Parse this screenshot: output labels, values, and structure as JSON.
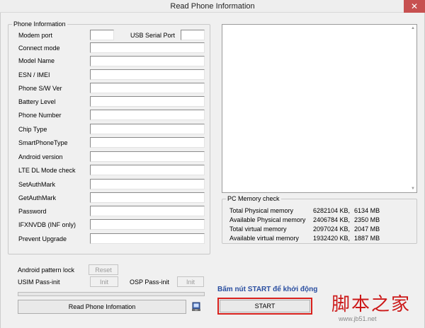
{
  "window": {
    "title": "Read Phone Information",
    "close_glyph": "✕"
  },
  "phone_info": {
    "group_label": "Phone Information",
    "modem_port_label": "Modem port",
    "usb_serial_port_label": "USB Serial Port",
    "fields": [
      "Connect mode",
      "Model Name",
      "ESN / IMEI",
      "Phone S/W Ver",
      "Battery Level",
      "Phone Number",
      "Chip Type",
      "SmartPhoneType",
      "Android version",
      "LTE DL Mode check",
      "SetAuthMark",
      "GetAuthMark",
      "Password",
      "IFXNVDB (INF only)",
      "Prevent Upgrade"
    ]
  },
  "actions": {
    "android_pattern_lock_label": "Android pattern lock",
    "reset_label": "Reset",
    "usim_pass_init_label": "USIM Pass-init",
    "osp_pass_init_label": "OSP Pass-init",
    "init_label": "Init",
    "read_phone_info_label": "Read Phone Infomation",
    "phone_icon": "phone-icon"
  },
  "pc_memory": {
    "group_label": "PC Memory check",
    "rows": [
      {
        "label": "Total Physical memory",
        "kb": "6282104 KB,",
        "mb": "6134 MB"
      },
      {
        "label": "Available Physical memory",
        "kb": "2406784 KB,",
        "mb": "2350 MB"
      },
      {
        "label": "Total virtual memory",
        "kb": "2097024 KB,",
        "mb": "2047 MB"
      },
      {
        "label": "Available virtual memory",
        "kb": "1932420 KB,",
        "mb": "1887 MB"
      }
    ]
  },
  "start": {
    "hint": "Bấm nút START để khởi động",
    "label": "START"
  },
  "watermark": {
    "main": "脚本之家",
    "sub": "www.jb51.net"
  },
  "colors": {
    "accent_red": "#d8201c",
    "hint_blue": "#2a4ea0",
    "close_red": "#c75050"
  }
}
